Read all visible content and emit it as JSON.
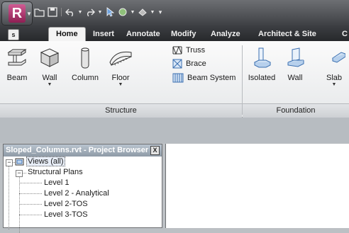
{
  "app": {
    "logo_letter": "R",
    "key_tip": "s"
  },
  "quick_access": {
    "icons": [
      "open-icon",
      "save-icon",
      "undo-icon",
      "undo-dropdown-icon",
      "redo-icon",
      "redo-dropdown-icon",
      "select-icon",
      "sync-icon",
      "sync-dropdown-icon",
      "measure-icon",
      "measure-dropdown-icon",
      "customize-dropdown-icon"
    ]
  },
  "tabs": [
    "Home",
    "Insert",
    "Annotate",
    "Modify",
    "Analyze",
    "Architect & Site",
    "C"
  ],
  "active_tab": "Home",
  "ribbon": {
    "structure": {
      "panel_label": "Structure",
      "tools": [
        {
          "label": "Beam",
          "icon": "beam-icon",
          "dropdown": false
        },
        {
          "label": "Wall",
          "icon": "wall-icon",
          "dropdown": true
        },
        {
          "label": "Column",
          "icon": "column-icon",
          "dropdown": false
        },
        {
          "label": "Floor",
          "icon": "floor-icon",
          "dropdown": true
        }
      ],
      "small_tools": [
        {
          "label": "Truss",
          "icon": "truss-icon"
        },
        {
          "label": "Brace",
          "icon": "brace-icon"
        },
        {
          "label": "Beam System",
          "icon": "beam-system-icon"
        }
      ]
    },
    "foundation": {
      "panel_label": "Foundation",
      "tools": [
        {
          "label": "Isolated",
          "icon": "isolated-foundation-icon",
          "dropdown": false
        },
        {
          "label": "Wall",
          "icon": "wall-foundation-icon",
          "dropdown": false
        },
        {
          "label": "Slab",
          "icon": "slab-icon",
          "dropdown": true
        }
      ]
    }
  },
  "project_browser": {
    "title": "Sloped_Columns.rvt - Project Browser",
    "close_label": "X",
    "root": "Views (all)",
    "group": "Structural Plans",
    "items": [
      "Level 1",
      "Level 2 - Analytical",
      "Level 2-TOS",
      "Level 3-TOS"
    ]
  }
}
